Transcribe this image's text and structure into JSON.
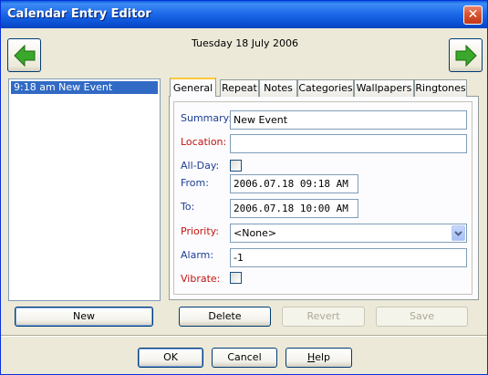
{
  "window": {
    "title": "Calendar Entry Editor",
    "close_glyph": "✕"
  },
  "header": {
    "date": "Tuesday 18 July 2006",
    "prev_icon": "left-arrow-icon",
    "next_icon": "right-arrow-icon",
    "arrow_color": "#3aa82a"
  },
  "entries": [
    {
      "label": "9:18 am New Event",
      "selected": true
    }
  ],
  "left_buttons": {
    "new": "New"
  },
  "tabs": [
    {
      "label": "General",
      "active": true
    },
    {
      "label": "Repeat"
    },
    {
      "label": "Notes"
    },
    {
      "label": "Categories"
    },
    {
      "label": "Wallpapers"
    },
    {
      "label": "Ringtones"
    }
  ],
  "form": {
    "summary": {
      "label": "Summary:",
      "value": "New Event"
    },
    "location": {
      "label": "Location:",
      "value": ""
    },
    "allday": {
      "label": "All-Day:",
      "checked": false
    },
    "from": {
      "label": "From:",
      "value": "2006.07.18 09:18 AM"
    },
    "to": {
      "label": "To:",
      "value": "2006.07.18 10:00 AM"
    },
    "priority": {
      "label": "Priority:",
      "value": "<None>"
    },
    "alarm": {
      "label": "Alarm:",
      "value": "-1"
    },
    "vibrate": {
      "label": "Vibrate:",
      "checked": false
    }
  },
  "action_buttons": {
    "delete": "Delete",
    "revert": "Revert",
    "save": "Save"
  },
  "footer": {
    "ok": "OK",
    "cancel": "Cancel",
    "help_prefix": "H",
    "help_rest": "elp"
  },
  "colors": {
    "label_blue": "#1c3e94",
    "label_red": "#c3140f",
    "selection": "#316ac5",
    "title_bar": "#0b52d4"
  }
}
